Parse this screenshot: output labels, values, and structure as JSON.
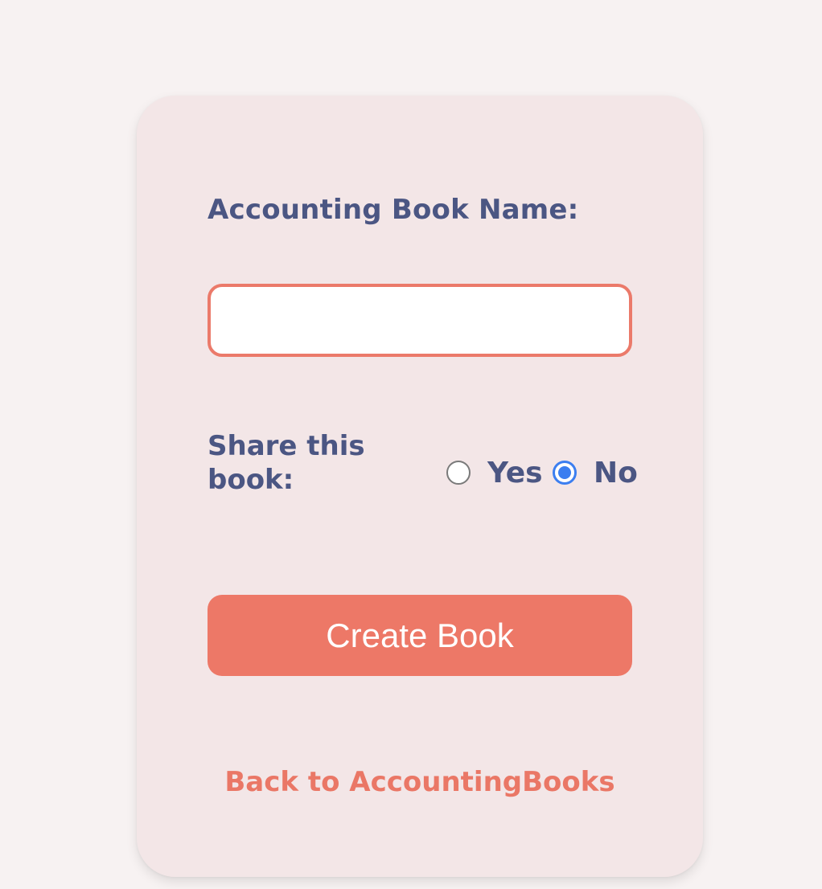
{
  "form": {
    "name_label": "Accounting Book Name:",
    "name_value": "",
    "share_label": "Share this book:",
    "options": [
      {
        "label": "Yes",
        "selected": false
      },
      {
        "label": "No",
        "selected": true
      }
    ],
    "submit_label": "Create Book",
    "back_label": "Back to AccountingBooks"
  },
  "colors": {
    "page_background": "#f7f2f2",
    "card_background": "#f3e6e7",
    "label_text": "#4b5683",
    "accent": "#ed7867",
    "radio_selected": "#3b7ef0"
  }
}
